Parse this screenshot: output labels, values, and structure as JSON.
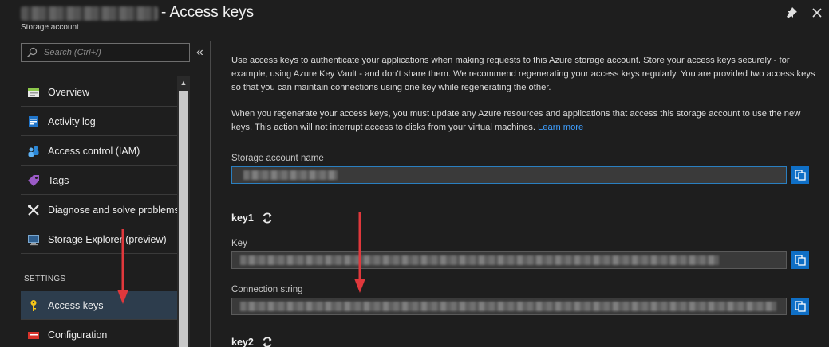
{
  "header": {
    "title": "- Access keys",
    "subtitle": "Storage account"
  },
  "search": {
    "placeholder": "Search (Ctrl+/)"
  },
  "sidebar": {
    "items": [
      {
        "label": "Overview",
        "icon": "overview-icon"
      },
      {
        "label": "Activity log",
        "icon": "activity-log-icon"
      },
      {
        "label": "Access control (IAM)",
        "icon": "iam-icon"
      },
      {
        "label": "Tags",
        "icon": "tag-icon"
      },
      {
        "label": "Diagnose and solve problems",
        "icon": "wrench-icon"
      },
      {
        "label": "Storage Explorer (preview)",
        "icon": "storage-explorer-icon"
      }
    ],
    "section_settings": "SETTINGS",
    "settings_items": [
      {
        "label": "Access keys",
        "icon": "key-icon",
        "active": true
      },
      {
        "label": "Configuration",
        "icon": "configuration-icon"
      }
    ]
  },
  "main": {
    "intro": "Use access keys to authenticate your applications when making requests to this Azure storage account. Store your access keys securely - for example, using Azure Key Vault - and don't share them. We recommend regenerating your access keys regularly. You are provided two access keys so that you can maintain connections using one key while regenerating the other.",
    "regen_note": "When you regenerate your access keys, you must update any Azure resources and applications that access this storage account to use the new keys. This action will not interrupt access to disks from your virtual machines.",
    "learn_more": "Learn more",
    "storage_account_name_label": "Storage account name",
    "key1_heading": "key1",
    "key_label": "Key",
    "connection_string_label": "Connection string",
    "key2_heading": "key2"
  },
  "colors": {
    "background": "#1e1e1e",
    "accent": "#0f6fc6",
    "link": "#3f9fff",
    "annotation_arrow": "#e0383c"
  }
}
